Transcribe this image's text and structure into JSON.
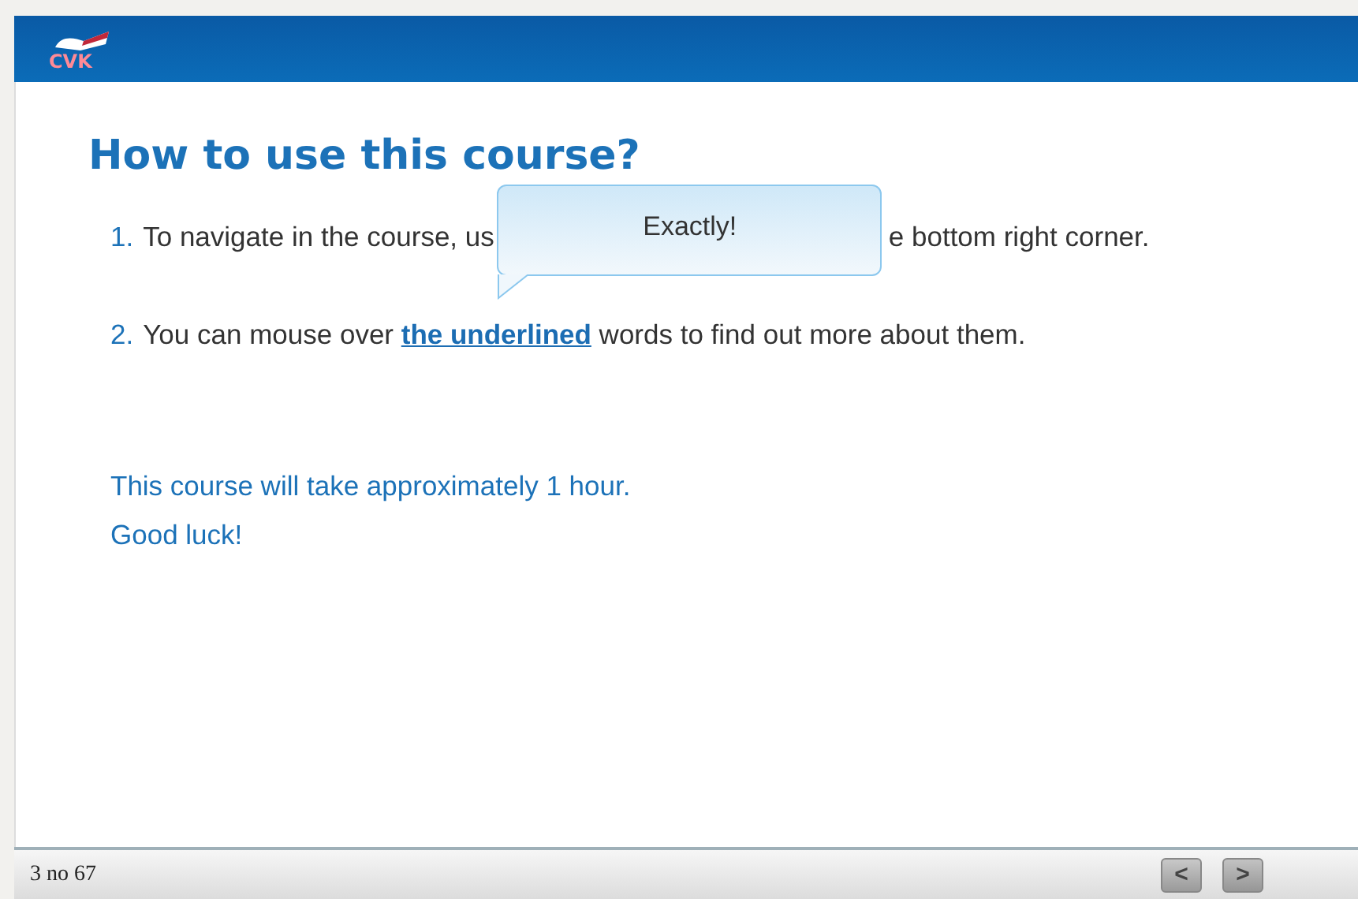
{
  "header": {
    "logo": {
      "text": "CVK"
    }
  },
  "title": "How to use this course?",
  "steps": [
    {
      "number": "1.",
      "parts": [
        "To navigate in the course, us",
        "e bottom right corner."
      ],
      "kind": "covered"
    },
    {
      "number": "2.",
      "parts": [
        "You can mouse over ",
        "the underlined",
        " words to find out more about them."
      ],
      "kind": "link"
    }
  ],
  "notes": [
    "This course will take approximately 1 hour.",
    "Good luck!"
  ],
  "tooltip": {
    "text": "Exactly!"
  },
  "footer": {
    "page": "3 no 67",
    "buttons": [
      {
        "label": "<",
        "kind": "prev"
      },
      {
        "label": ">",
        "kind": "next"
      }
    ]
  }
}
